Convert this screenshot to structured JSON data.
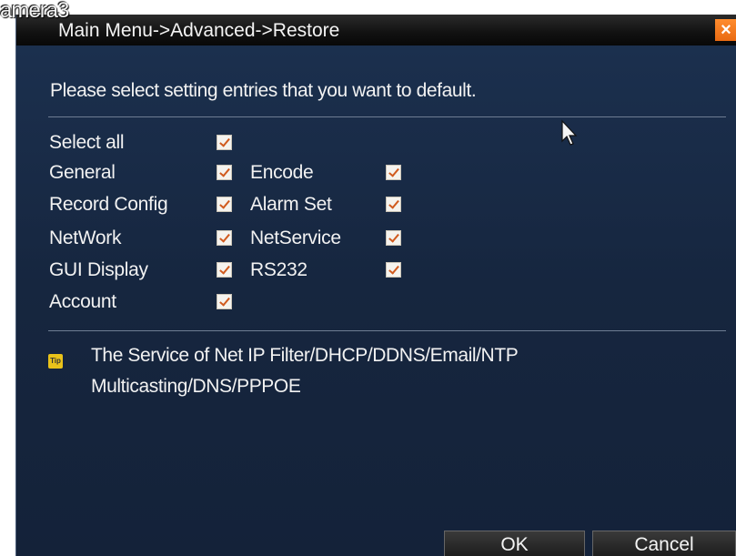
{
  "overlay": {
    "camera_text": "amera3"
  },
  "window": {
    "title": "Main Menu->Advanced->Restore",
    "close_label": "×"
  },
  "instruction": "Please select setting entries that you want to default.",
  "options": [
    {
      "label": "Select all",
      "checked": true
    },
    {
      "label": "General",
      "checked": true
    },
    {
      "label": "Encode",
      "checked": true
    },
    {
      "label": "Record Config",
      "checked": true
    },
    {
      "label": "Alarm Set",
      "checked": true
    },
    {
      "label": "NetWork",
      "checked": true
    },
    {
      "label": "NetService",
      "checked": true
    },
    {
      "label": "GUI Display",
      "checked": true
    },
    {
      "label": "RS232",
      "checked": true
    },
    {
      "label": "Account",
      "checked": true
    }
  ],
  "info": {
    "icon_label": "Tip",
    "line1": "The Service of Net IP Filter/DHCP/DDNS/Email/NTP",
    "line2": "Multicasting/DNS/PPPOE"
  },
  "buttons": {
    "ok": "OK",
    "cancel": "Cancel"
  },
  "colors": {
    "dialog_bg": "#16263f",
    "check": "#d05a1e",
    "close": "#e96a12",
    "info_icon": "#e9c21a"
  }
}
